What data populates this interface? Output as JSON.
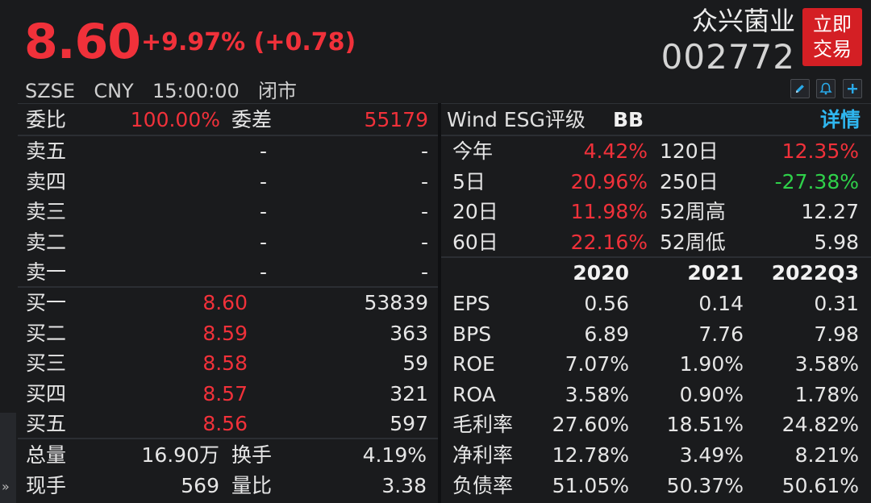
{
  "quote": {
    "price": "8.60",
    "change": "+9.97% (+0.78)",
    "name": "众兴菌业",
    "code": "002772",
    "trade_button": "立即\n交易",
    "status": "SZSE  CNY  15:00:00  闭市"
  },
  "toolbar": {
    "edit_icon": "pencil-icon",
    "alert_icon": "bell-icon",
    "add_icon": "plus-icon"
  },
  "order_book": {
    "weibi_label": "委比",
    "weibi_value": "100.00%",
    "weicha_label": "委差",
    "weicha_value": "55179",
    "asks": [
      {
        "label": "卖五",
        "price": "-",
        "volume": "-"
      },
      {
        "label": "卖四",
        "price": "-",
        "volume": "-"
      },
      {
        "label": "卖三",
        "price": "-",
        "volume": "-"
      },
      {
        "label": "卖二",
        "price": "-",
        "volume": "-"
      },
      {
        "label": "卖一",
        "price": "-",
        "volume": "-"
      }
    ],
    "bids": [
      {
        "label": "买一",
        "price": "8.60",
        "volume": "53839"
      },
      {
        "label": "买二",
        "price": "8.59",
        "volume": "363"
      },
      {
        "label": "买三",
        "price": "8.58",
        "volume": "59"
      },
      {
        "label": "买四",
        "price": "8.57",
        "volume": "321"
      },
      {
        "label": "买五",
        "price": "8.56",
        "volume": "597"
      }
    ],
    "stats": [
      {
        "label1": "总量",
        "value1": "16.90万",
        "label2": "换手",
        "value2": "4.19%"
      },
      {
        "label1": "现手",
        "value1": "569",
        "label2": "量比",
        "value2": "3.38"
      }
    ],
    "expand_icon": "»"
  },
  "esg": {
    "label": "Wind ESG评级",
    "rating": "BB",
    "detail": "详情"
  },
  "performance": [
    {
      "label1": "今年",
      "value1": "4.42%",
      "label2": "120日",
      "value2": "12.35%"
    },
    {
      "label1": "5日",
      "value1": "20.96%",
      "label2": "250日",
      "value2": "-27.38%"
    },
    {
      "label1": "20日",
      "value1": "11.98%",
      "label2": "52周高",
      "value2": "12.27"
    },
    {
      "label1": "60日",
      "value1": "22.16%",
      "label2": "52周低",
      "value2": "5.98"
    }
  ],
  "financials": {
    "headers": [
      "2020",
      "2021",
      "2022Q3"
    ],
    "rows": [
      {
        "label": "EPS",
        "values": [
          "0.56",
          "0.14",
          "0.31"
        ]
      },
      {
        "label": "BPS",
        "values": [
          "6.89",
          "7.76",
          "7.98"
        ]
      },
      {
        "label": "ROE",
        "values": [
          "7.07%",
          "1.90%",
          "3.58%"
        ]
      },
      {
        "label": "ROA",
        "values": [
          "3.58%",
          "0.90%",
          "1.78%"
        ]
      },
      {
        "label": "毛利率",
        "values": [
          "27.60%",
          "18.51%",
          "24.82%"
        ]
      },
      {
        "label": "净利率",
        "values": [
          "12.78%",
          "3.49%",
          "8.21%"
        ]
      },
      {
        "label": "负债率",
        "values": [
          "51.05%",
          "50.37%",
          "50.61%"
        ]
      }
    ]
  },
  "colors": {
    "up": "#f0313a",
    "down": "#2fd14a",
    "link": "#2fb6ef",
    "trade_button": "#d41f24",
    "background": "#1a1b1d"
  }
}
